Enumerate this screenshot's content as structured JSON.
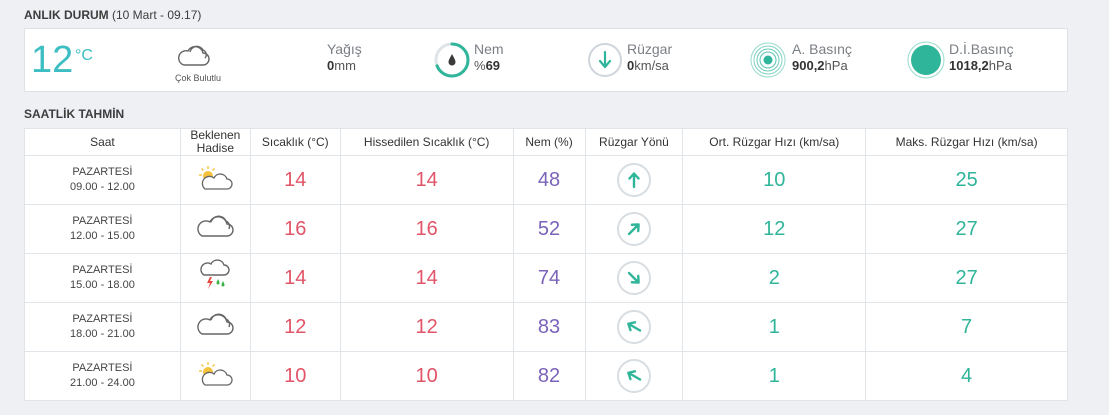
{
  "current": {
    "section_title": "ANLIK DURUM",
    "section_subtitle": "(10 Mart - 09.17)",
    "temperature": "12",
    "temperature_unit": "°C",
    "condition_icon": "cloud-icon",
    "condition_label": "Çok Bulutlu",
    "precip_label": "Yağış",
    "precip_value": "0",
    "precip_unit": "mm",
    "humidity_label": "Nem",
    "humidity_prefix": "%",
    "humidity_value": "69",
    "humidity_fraction": 0.69,
    "wind_label": "Rüzgar",
    "wind_value": "0",
    "wind_unit": "km/sa",
    "pressure_label": "A. Basınç",
    "pressure_value": "900,2",
    "pressure_unit": "hPa",
    "sea_pressure_label": "D.İ.Basınç",
    "sea_pressure_value": "1018,2",
    "sea_pressure_unit": "hPa",
    "accent_color": "#3cbec2",
    "green_color": "#2fb59a"
  },
  "hourly": {
    "section_title": "SAATLİK TAHMİN",
    "columns": {
      "time": "Saat",
      "event_line1": "Beklenen",
      "event_line2": "Hadise",
      "temp": "Sıcaklık (°C)",
      "feels": "Hissedilen Sıcaklık (°C)",
      "humidity": "Nem (%)",
      "wind_dir": "Rüzgar Yönü",
      "wind_avg": "Ort. Rüzgar Hızı (km/sa)",
      "wind_max": "Maks. Rüzgar Hızı (km/sa)"
    },
    "rows": [
      {
        "day": "PAZARTESİ",
        "range": "09.00 - 12.00",
        "icon": "partly-cloudy-icon",
        "temp": "14",
        "feels": "14",
        "humidity": "48",
        "wind_dir_deg": 0,
        "wind_avg": "10",
        "wind_max": "25"
      },
      {
        "day": "PAZARTESİ",
        "range": "12.00 - 15.00",
        "icon": "cloud-icon",
        "temp": "16",
        "feels": "16",
        "humidity": "52",
        "wind_dir_deg": 45,
        "wind_avg": "12",
        "wind_max": "27"
      },
      {
        "day": "PAZARTESİ",
        "range": "15.00 - 18.00",
        "icon": "thunderstorm-icon",
        "temp": "14",
        "feels": "14",
        "humidity": "74",
        "wind_dir_deg": 135,
        "wind_avg": "2",
        "wind_max": "27"
      },
      {
        "day": "PAZARTESİ",
        "range": "18.00 - 21.00",
        "icon": "cloud-icon",
        "temp": "12",
        "feels": "12",
        "humidity": "83",
        "wind_dir_deg": 300,
        "wind_avg": "1",
        "wind_max": "7"
      },
      {
        "day": "PAZARTESİ",
        "range": "21.00 - 24.00",
        "icon": "partly-cloudy-icon",
        "temp": "10",
        "feels": "10",
        "humidity": "82",
        "wind_dir_deg": 300,
        "wind_avg": "1",
        "wind_max": "4"
      }
    ]
  }
}
